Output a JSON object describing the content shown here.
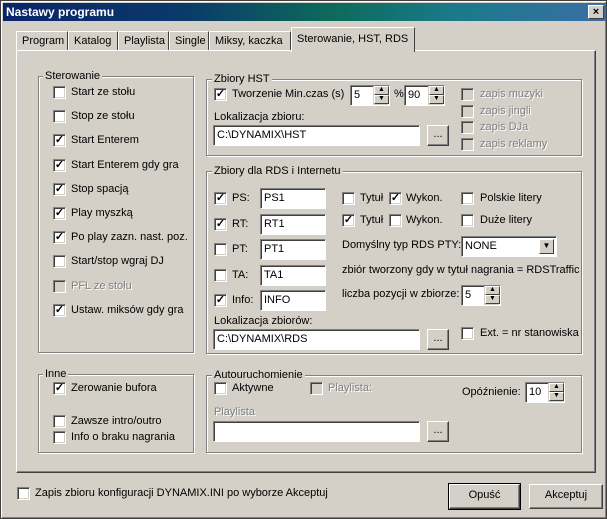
{
  "window": {
    "title": "Nastawy programu",
    "close": "×"
  },
  "tabs": [
    "Program",
    "Katalog",
    "Playlista",
    "Single",
    "Miksy, kaczka",
    "Sterowanie, HST, RDS"
  ],
  "sterowanie": {
    "title": "Sterowanie",
    "items": [
      {
        "label": "Start ze stołu",
        "checked": false,
        "disabled": false
      },
      {
        "label": "Stop ze stołu",
        "checked": false,
        "disabled": false
      },
      {
        "label": "Start Enterem",
        "checked": true,
        "disabled": false
      },
      {
        "label": "Start Enterem gdy gra",
        "checked": true,
        "disabled": false
      },
      {
        "label": "Stop spacją",
        "checked": true,
        "disabled": false
      },
      {
        "label": "Play myszką",
        "checked": true,
        "disabled": false
      },
      {
        "label": "Po play zazn. nast. poz.",
        "checked": true,
        "disabled": false
      },
      {
        "label": "Start/stop wgraj DJ",
        "checked": false,
        "disabled": false
      },
      {
        "label": "PFL ze stołu",
        "checked": false,
        "disabled": true
      },
      {
        "label": "Ustaw. miksów gdy gra",
        "checked": true,
        "disabled": false
      }
    ]
  },
  "inne": {
    "title": "Inne",
    "items": [
      {
        "label": "Zerowanie bufora",
        "checked": true
      },
      {
        "label": "Zawsze intro/outro",
        "checked": false
      },
      {
        "label": "Info o braku nagrania",
        "checked": false
      }
    ]
  },
  "hst": {
    "title": "Zbiory HST",
    "tworzenie_label": "Tworzenie",
    "tworzenie_checked": true,
    "min_czas_label": "Min.czas (s)",
    "min_czas_value": "5",
    "percent_label": "%",
    "percent_value": "90",
    "lokalizacja_label": "Lokalizacja zbioru:",
    "lokalizacja_value": "C:\\DYNAMIX\\HST",
    "browse": "...",
    "zapis": [
      "zapis muzyki",
      "zapis jingli",
      "zapis DJa",
      "zapis reklamy"
    ]
  },
  "rds": {
    "title": "Zbiory dla RDS i Internetu",
    "rows": [
      {
        "label": "PS:",
        "checked": true,
        "value": "PS1"
      },
      {
        "label": "RT:",
        "checked": true,
        "value": "RT1"
      },
      {
        "label": "PT:",
        "checked": false,
        "value": "PT1"
      },
      {
        "label": "TA:",
        "checked": false,
        "value": "TA1"
      },
      {
        "label": "Info:",
        "checked": true,
        "value": "INFO"
      }
    ],
    "tytul1": {
      "label": "Tytuł",
      "checked": false
    },
    "wykon1": {
      "label": "Wykon.",
      "checked": true
    },
    "tytul2": {
      "label": "Tytuł",
      "checked": true
    },
    "wykon2": {
      "label": "Wykon.",
      "checked": false
    },
    "polskie": {
      "label": "Polskie litery",
      "checked": false
    },
    "duze": {
      "label": "Duże litery",
      "checked": false
    },
    "pty_label": "Domyślny typ RDS PTY:",
    "pty_value": "NONE",
    "traffic_label": "zbiór tworzony gdy w tytuł nagrania = RDSTraffic",
    "liczba_label": "liczba pozycji w zbiorze:",
    "liczba_value": "5",
    "lokalizacja_label": "Lokalizacja zbiorów:",
    "lokalizacja_value": "C:\\DYNAMIX\\RDS",
    "browse": "...",
    "ext_label": "Ext. = nr stanowiska",
    "ext_checked": false
  },
  "auto": {
    "title": "Autouruchomienie",
    "aktywne_label": "Aktywne",
    "aktywne_checked": false,
    "playlista_cb_label": "Playlista:",
    "opoznienie_label": "Opóźnienie:",
    "opoznienie_value": "10",
    "playlista_label": "Playlista",
    "playlista_value": "",
    "browse": "..."
  },
  "footer": {
    "zapis_label": "Zapis zbioru konfiguracji DYNAMIX.INI po wyborze Akceptuj",
    "zapis_checked": false,
    "cancel": "Opuść",
    "accept": "Akceptuj"
  }
}
